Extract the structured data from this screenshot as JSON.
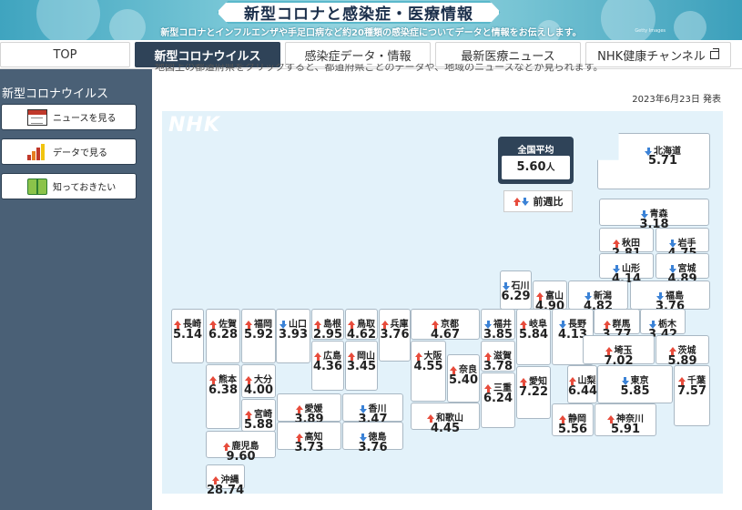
{
  "banner": {
    "title": "新型コロナと感染症・医療情報",
    "subtitle": "新型コロナとインフルエンザや手足口病など約20種類の感染症についてデータと情報をお伝えします。",
    "credit": "Getty Images"
  },
  "tabs": [
    {
      "label": "TOP"
    },
    {
      "label": "新型コロナウイルス"
    },
    {
      "label": "感染症データ・情報"
    },
    {
      "label": "最新医療ニュース"
    },
    {
      "label": "NHK健康チャンネル"
    }
  ],
  "sidebar": {
    "title": "新型コロナウイルス",
    "items": [
      {
        "label": "ニュースを見る",
        "icon": "newspaper-icon"
      },
      {
        "label": "データで見る",
        "icon": "bar-chart-icon"
      },
      {
        "label": "知っておきたい",
        "icon": "book-icon"
      }
    ]
  },
  "main": {
    "cutoff_text": "地図上の都道府県をクリックすると、都道府県ごとのデータや、地域のニュースなどが見られます。",
    "date": "2023年6月23日 発表",
    "logo": "NHK",
    "national_average": {
      "label": "全国平均",
      "value": "5.60",
      "unit": "人"
    },
    "legend_label": "前週比",
    "colors": {
      "up": "#e74c3c",
      "down": "#3b82d6",
      "map_bg": "#e3f2fa",
      "accent": "#2f4358"
    }
  },
  "prefectures": [
    {
      "id": "hokkaido",
      "name": "北海道",
      "value": "5.71",
      "trend": "down"
    },
    {
      "id": "aomori",
      "name": "青森",
      "value": "3.18",
      "trend": "down"
    },
    {
      "id": "akita",
      "name": "秋田",
      "value": "2.81",
      "trend": "up"
    },
    {
      "id": "iwate",
      "name": "岩手",
      "value": "4.75",
      "trend": "down"
    },
    {
      "id": "yamagata",
      "name": "山形",
      "value": "4.14",
      "trend": "down"
    },
    {
      "id": "miyagi",
      "name": "宮城",
      "value": "4.89",
      "trend": "down"
    },
    {
      "id": "ishikawa",
      "name": "石川",
      "value": "6.29",
      "trend": "down"
    },
    {
      "id": "toyama",
      "name": "富山",
      "value": "4.90",
      "trend": "up"
    },
    {
      "id": "niigata",
      "name": "新潟",
      "value": "4.82",
      "trend": "down"
    },
    {
      "id": "fukushima",
      "name": "福島",
      "value": "3.76",
      "trend": "down"
    },
    {
      "id": "nagasaki",
      "name": "長崎",
      "value": "5.14",
      "trend": "up"
    },
    {
      "id": "saga",
      "name": "佐賀",
      "value": "6.28",
      "trend": "up"
    },
    {
      "id": "fukuoka",
      "name": "福岡",
      "value": "5.92",
      "trend": "up"
    },
    {
      "id": "yamaguchi",
      "name": "山口",
      "value": "3.93",
      "trend": "down"
    },
    {
      "id": "shimane",
      "name": "島根",
      "value": "2.95",
      "trend": "up"
    },
    {
      "id": "tottori",
      "name": "鳥取",
      "value": "4.62",
      "trend": "up"
    },
    {
      "id": "hyogo",
      "name": "兵庫",
      "value": "3.76",
      "trend": "up"
    },
    {
      "id": "kyoto",
      "name": "京都",
      "value": "4.67",
      "trend": "up"
    },
    {
      "id": "fukui",
      "name": "福井",
      "value": "3.85",
      "trend": "down"
    },
    {
      "id": "gifu",
      "name": "岐阜",
      "value": "5.84",
      "trend": "up"
    },
    {
      "id": "nagano",
      "name": "長野",
      "value": "4.13",
      "trend": "down"
    },
    {
      "id": "gunma",
      "name": "群馬",
      "value": "3.77",
      "trend": "up"
    },
    {
      "id": "tochigi",
      "name": "栃木",
      "value": "3.42",
      "trend": "down"
    },
    {
      "id": "hiroshima",
      "name": "広島",
      "value": "4.36",
      "trend": "up"
    },
    {
      "id": "okayama",
      "name": "岡山",
      "value": "3.45",
      "trend": "up"
    },
    {
      "id": "osaka",
      "name": "大阪",
      "value": "4.55",
      "trend": "up"
    },
    {
      "id": "shiga",
      "name": "滋賀",
      "value": "3.78",
      "trend": "up"
    },
    {
      "id": "saitama",
      "name": "埼玉",
      "value": "7.02",
      "trend": "up"
    },
    {
      "id": "ibaraki",
      "name": "茨城",
      "value": "5.89",
      "trend": "up"
    },
    {
      "id": "nara",
      "name": "奈良",
      "value": "5.40",
      "trend": "up"
    },
    {
      "id": "aichi",
      "name": "愛知",
      "value": "7.22",
      "trend": "up"
    },
    {
      "id": "yamanashi",
      "name": "山梨",
      "value": "6.44",
      "trend": "up"
    },
    {
      "id": "tokyo",
      "name": "東京",
      "value": "5.85",
      "trend": "down"
    },
    {
      "id": "chiba",
      "name": "千葉",
      "value": "7.57",
      "trend": "up"
    },
    {
      "id": "oita",
      "name": "大分",
      "value": "4.00",
      "trend": "up"
    },
    {
      "id": "kumamoto",
      "name": "熊本",
      "value": "6.38",
      "trend": "up"
    },
    {
      "id": "ehime",
      "name": "愛媛",
      "value": "3.89",
      "trend": "up"
    },
    {
      "id": "kagawa",
      "name": "香川",
      "value": "3.47",
      "trend": "down"
    },
    {
      "id": "mie",
      "name": "三重",
      "value": "6.24",
      "trend": "up"
    },
    {
      "id": "miyazaki",
      "name": "宮崎",
      "value": "5.88",
      "trend": "up"
    },
    {
      "id": "kochi",
      "name": "高知",
      "value": "3.73",
      "trend": "up"
    },
    {
      "id": "tokushima",
      "name": "徳島",
      "value": "3.76",
      "trend": "down"
    },
    {
      "id": "wakayama",
      "name": "和歌山",
      "value": "4.45",
      "trend": "up"
    },
    {
      "id": "shizuoka",
      "name": "静岡",
      "value": "5.56",
      "trend": "up"
    },
    {
      "id": "kanagawa",
      "name": "神奈川",
      "value": "5.91",
      "trend": "up"
    },
    {
      "id": "kagoshima",
      "name": "鹿児島",
      "value": "9.60",
      "trend": "up"
    },
    {
      "id": "okinawa",
      "name": "沖縄",
      "value": "28.74",
      "trend": "up"
    }
  ]
}
